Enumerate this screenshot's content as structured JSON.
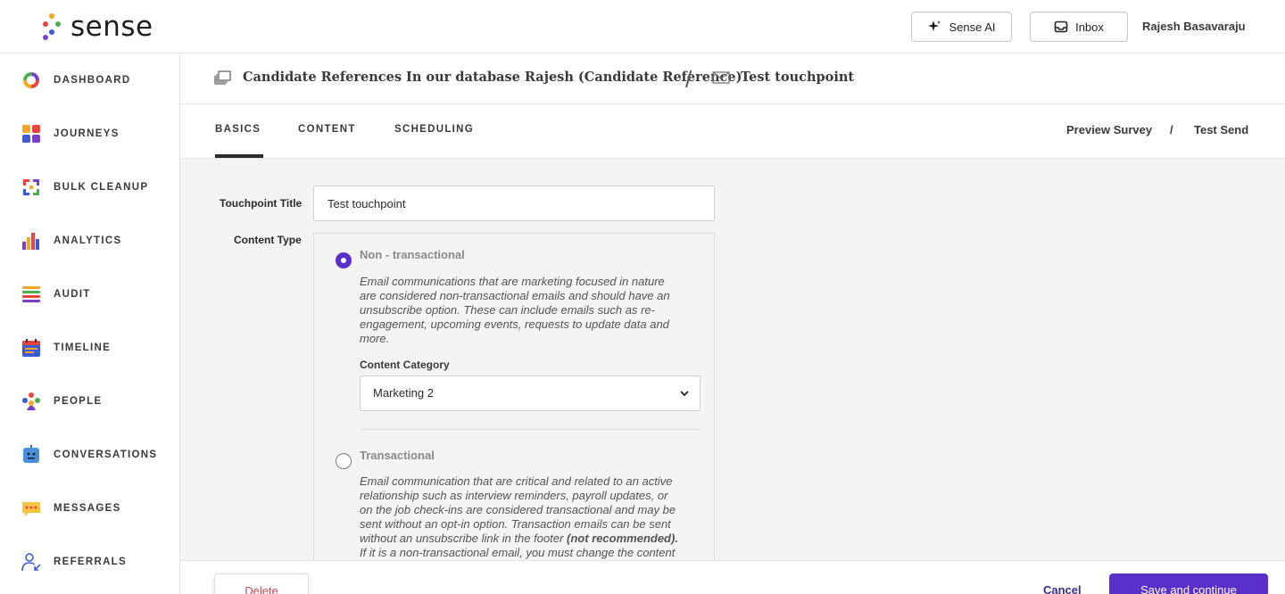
{
  "brand": {
    "name": "sense"
  },
  "header": {
    "ai_button": "Sense AI",
    "inbox_button": "Inbox",
    "user_name": "Rajesh Basavaraju"
  },
  "sidebar": {
    "items": [
      {
        "label": "DASHBOARD",
        "icon": "dashboard-icon"
      },
      {
        "label": "JOURNEYS",
        "icon": "journeys-icon"
      },
      {
        "label": "BULK CLEANUP",
        "icon": "bulk-cleanup-icon"
      },
      {
        "label": "ANALYTICS",
        "icon": "analytics-icon"
      },
      {
        "label": "AUDIT",
        "icon": "audit-icon"
      },
      {
        "label": "TIMELINE",
        "icon": "timeline-icon"
      },
      {
        "label": "PEOPLE",
        "icon": "people-icon"
      },
      {
        "label": "CONVERSATIONS",
        "icon": "conversations-icon"
      },
      {
        "label": "MESSAGES",
        "icon": "messages-icon"
      },
      {
        "label": "REFERRALS",
        "icon": "referrals-icon"
      }
    ]
  },
  "breadcrumb": {
    "journey": "Candidate References In our database Rajesh (Candidate Reference)",
    "separator": "/",
    "touchpoint": "Test touchpoint"
  },
  "tabs": {
    "items": [
      "BASICS",
      "CONTENT",
      "SCHEDULING"
    ],
    "active": "BASICS",
    "preview": "Preview Survey",
    "separator": "/",
    "test_send": "Test Send"
  },
  "form": {
    "title_label": "Touchpoint Title",
    "title_value": "Test touchpoint",
    "content_type_label": "Content Type",
    "non_transactional": {
      "title": "Non - transactional",
      "selected": true,
      "desc_lines": [
        "Email communications that are marketing focused in nature",
        "are considered non-transactional emails and should have an",
        "unsubscribe option. These can include emails such as re-",
        "engagement, upcoming events, requests to update data and",
        "more."
      ]
    },
    "content_category_label": "Content Category",
    "content_category_value": "Marketing 2",
    "transactional": {
      "title": "Transactional",
      "selected": false,
      "desc_lines": [
        "Email communication that are critical and related to an active",
        "relationship such as interview reminders, payroll updates, or",
        "on the job check-ins are considered transactional and may be",
        "sent without an opt-in option. Transaction emails can be sent",
        "without an unsubscribe link in the footer",
        "(not recommended).",
        "If it is a non-transactional email, you must change the content"
      ]
    }
  },
  "footer": {
    "delete": "Delete",
    "cancel": "Cancel",
    "save": "Save and continue"
  },
  "colors": {
    "accent": "#5b2fc9",
    "delete_text": "#c14a5a"
  }
}
